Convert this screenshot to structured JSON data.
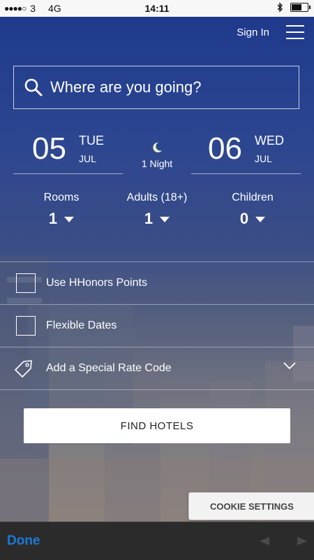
{
  "status_bar": {
    "signal_dots": "●●●●○",
    "carrier": "3",
    "network": "4G",
    "time": "14:11",
    "bluetooth_icon": "bluetooth-icon",
    "battery_level": 0.6
  },
  "nav": {
    "sign_in": "Sign In",
    "menu_icon": "hamburger-menu-icon"
  },
  "search": {
    "placeholder": "Where are you going?",
    "icon": "search-icon"
  },
  "check_in": {
    "day": "05",
    "weekday": "TUE",
    "month": "JUL"
  },
  "check_out": {
    "day": "06",
    "weekday": "WED",
    "month": "JUL"
  },
  "nights": {
    "icon": "moon-icon",
    "label": "1 Night"
  },
  "guests": {
    "rooms": {
      "label": "Rooms",
      "value": "1"
    },
    "adults": {
      "label": "Adults (18+)",
      "value": "1"
    },
    "children": {
      "label": "Children",
      "value": "0"
    }
  },
  "options": {
    "hhonors": {
      "label": "Use HHonors Points",
      "checked": false
    },
    "flexible": {
      "label": "Flexible Dates",
      "checked": false
    },
    "rate_code": {
      "label": "Add a Special Rate Code",
      "icon": "tag-icon"
    }
  },
  "find_hotels": "FIND HOTELS",
  "cookie_settings": "COOKIE SETTINGS",
  "accessory": {
    "done": "Done"
  },
  "colors": {
    "accent_blue": "#1b7ad9",
    "header_blue": "#1f3a8c"
  }
}
